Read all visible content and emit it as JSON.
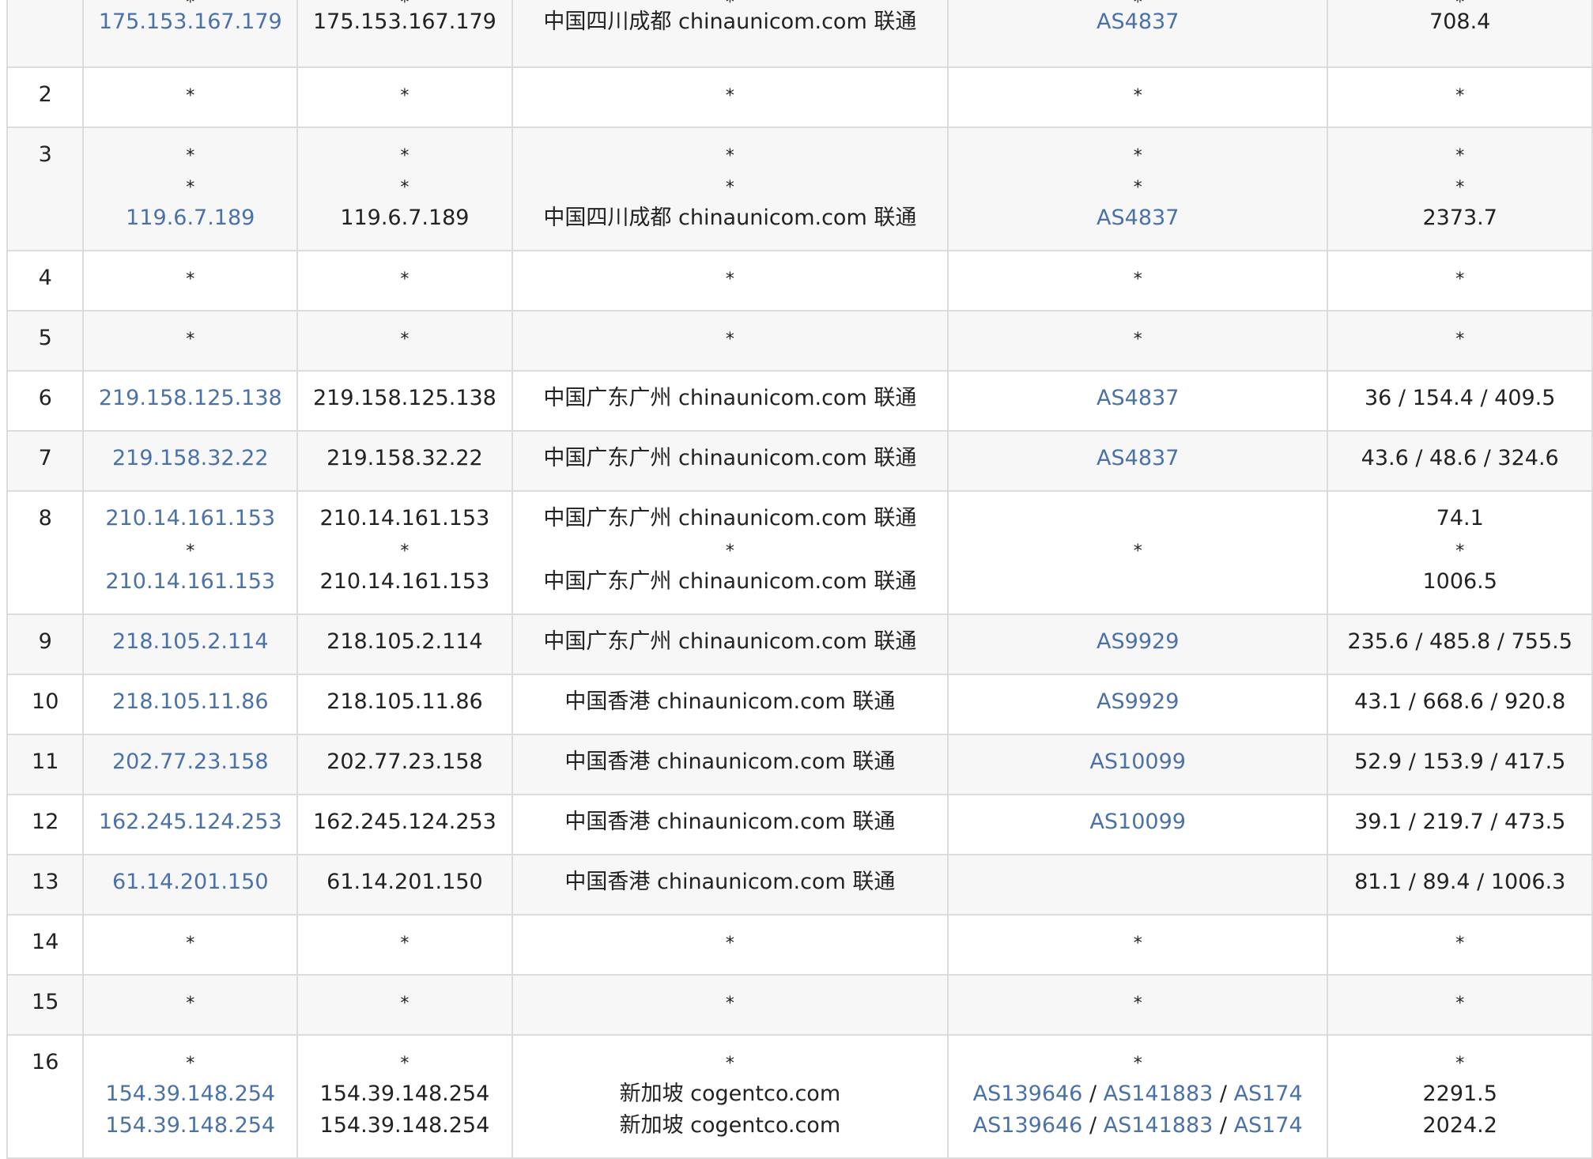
{
  "rows": [
    {
      "hop": "",
      "ip": [
        "*",
        "175.153.167.179"
      ],
      "host": [
        "*",
        "175.153.167.179"
      ],
      "loc": [
        "*",
        "中国四川成都 chinaunicom.com 联通"
      ],
      "asn": [
        [
          "*"
        ],
        [
          "AS4837"
        ]
      ],
      "time": [
        "*",
        "708.4"
      ]
    },
    {
      "hop": "2",
      "ip": [
        "*"
      ],
      "host": [
        "*"
      ],
      "loc": [
        "*"
      ],
      "asn": [
        [
          "*"
        ]
      ],
      "time": [
        "*"
      ]
    },
    {
      "hop": "3",
      "ip": [
        "*",
        "*",
        "119.6.7.189"
      ],
      "host": [
        "*",
        "*",
        "119.6.7.189"
      ],
      "loc": [
        "*",
        "*",
        "中国四川成都 chinaunicom.com 联通"
      ],
      "asn": [
        [
          "*"
        ],
        [
          "*"
        ],
        [
          "AS4837"
        ]
      ],
      "time": [
        "*",
        "*",
        "2373.7"
      ]
    },
    {
      "hop": "4",
      "ip": [
        "*"
      ],
      "host": [
        "*"
      ],
      "loc": [
        "*"
      ],
      "asn": [
        [
          "*"
        ]
      ],
      "time": [
        "*"
      ]
    },
    {
      "hop": "5",
      "ip": [
        "*"
      ],
      "host": [
        "*"
      ],
      "loc": [
        "*"
      ],
      "asn": [
        [
          "*"
        ]
      ],
      "time": [
        "*"
      ]
    },
    {
      "hop": "6",
      "ip": [
        "219.158.125.138"
      ],
      "host": [
        "219.158.125.138"
      ],
      "loc": [
        "中国广东广州 chinaunicom.com 联通"
      ],
      "asn": [
        [
          "AS4837"
        ]
      ],
      "time": [
        "36 / 154.4 / 409.5"
      ]
    },
    {
      "hop": "7",
      "ip": [
        "219.158.32.22"
      ],
      "host": [
        "219.158.32.22"
      ],
      "loc": [
        "中国广东广州 chinaunicom.com 联通"
      ],
      "asn": [
        [
          "AS4837"
        ]
      ],
      "time": [
        "43.6 / 48.6 / 324.6"
      ]
    },
    {
      "hop": "8",
      "ip": [
        "210.14.161.153",
        "*",
        "210.14.161.153"
      ],
      "host": [
        "210.14.161.153",
        "*",
        "210.14.161.153"
      ],
      "loc": [
        "中国广东广州 chinaunicom.com 联通",
        "*",
        "中国广东广州 chinaunicom.com 联通"
      ],
      "asn": [
        [],
        [
          "*"
        ],
        []
      ],
      "time": [
        "74.1",
        "*",
        "1006.5"
      ]
    },
    {
      "hop": "9",
      "ip": [
        "218.105.2.114"
      ],
      "host": [
        "218.105.2.114"
      ],
      "loc": [
        "中国广东广州 chinaunicom.com 联通"
      ],
      "asn": [
        [
          "AS9929"
        ]
      ],
      "time": [
        "235.6 / 485.8 / 755.5"
      ]
    },
    {
      "hop": "10",
      "ip": [
        "218.105.11.86"
      ],
      "host": [
        "218.105.11.86"
      ],
      "loc": [
        "中国香港 chinaunicom.com 联通"
      ],
      "asn": [
        [
          "AS9929"
        ]
      ],
      "time": [
        "43.1 / 668.6 / 920.8"
      ]
    },
    {
      "hop": "11",
      "ip": [
        "202.77.23.158"
      ],
      "host": [
        "202.77.23.158"
      ],
      "loc": [
        "中国香港 chinaunicom.com 联通"
      ],
      "asn": [
        [
          "AS10099"
        ]
      ],
      "time": [
        "52.9 / 153.9 / 417.5"
      ]
    },
    {
      "hop": "12",
      "ip": [
        "162.245.124.253"
      ],
      "host": [
        "162.245.124.253"
      ],
      "loc": [
        "中国香港 chinaunicom.com 联通"
      ],
      "asn": [
        [
          "AS10099"
        ]
      ],
      "time": [
        "39.1 / 219.7 / 473.5"
      ]
    },
    {
      "hop": "13",
      "ip": [
        "61.14.201.150"
      ],
      "host": [
        "61.14.201.150"
      ],
      "loc": [
        "中国香港 chinaunicom.com 联通"
      ],
      "asn": [
        []
      ],
      "time": [
        "81.1 / 89.4 / 1006.3"
      ]
    },
    {
      "hop": "14",
      "ip": [
        "*"
      ],
      "host": [
        "*"
      ],
      "loc": [
        "*"
      ],
      "asn": [
        [
          "*"
        ]
      ],
      "time": [
        "*"
      ]
    },
    {
      "hop": "15",
      "ip": [
        "*"
      ],
      "host": [
        "*"
      ],
      "loc": [
        "*"
      ],
      "asn": [
        [
          "*"
        ]
      ],
      "time": [
        "*"
      ]
    },
    {
      "hop": "16",
      "ip": [
        "*",
        "154.39.148.254",
        "154.39.148.254"
      ],
      "host": [
        "*",
        "154.39.148.254",
        "154.39.148.254"
      ],
      "loc": [
        "*",
        "新加坡 cogentco.com",
        "新加坡 cogentco.com"
      ],
      "asn": [
        [
          "*"
        ],
        [
          "AS139646",
          "AS141883",
          "AS174"
        ],
        [
          "AS139646",
          "AS141883",
          "AS174"
        ]
      ],
      "time": [
        "*",
        "2291.5",
        "2024.2"
      ]
    }
  ]
}
